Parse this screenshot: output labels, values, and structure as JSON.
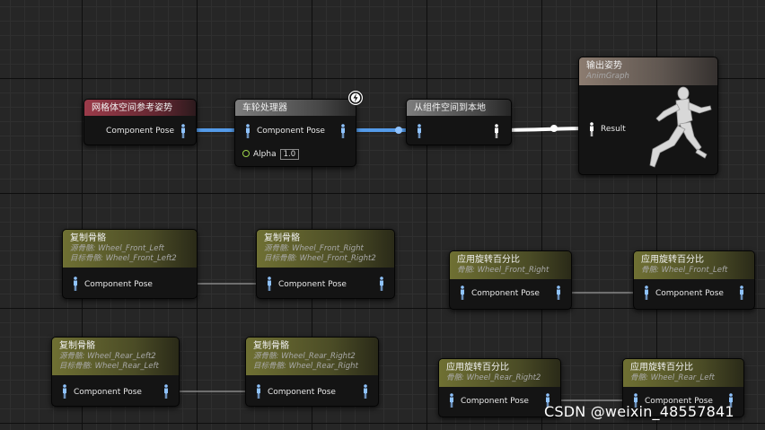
{
  "nodes": {
    "mesh_ref_pose": {
      "title": "网格体空间参考姿势",
      "pin": "Component Pose"
    },
    "wheel_handler": {
      "title": "车轮处理器",
      "pin": "Component Pose",
      "alpha_label": "Alpha",
      "alpha_value": "1.0"
    },
    "comp_to_local": {
      "title": "从组件空间到本地"
    },
    "output_pose": {
      "title": "输出姿势",
      "subtitle": "AnimGraph",
      "pin": "Result",
      "icon": "running-mannequin-icon"
    },
    "copy_bone_1": {
      "title": "复制骨骼",
      "source": "源骨骼: Wheel_Front_Left",
      "target": "目标骨骼: Wheel_Front_Left2",
      "pin": "Component Pose"
    },
    "copy_bone_2": {
      "title": "复制骨骼",
      "source": "源骨骼: Wheel_Front_Right",
      "target": "目标骨骼: Wheel_Front_Right2",
      "pin": "Component Pose"
    },
    "copy_bone_3": {
      "title": "复制骨骼",
      "source": "源骨骼: Wheel_Rear_Left2",
      "target": "目标骨骼: Wheel_Rear_Left",
      "pin": "Component Pose"
    },
    "copy_bone_4": {
      "title": "复制骨骼",
      "source": "源骨骼: Wheel_Rear_Right2",
      "target": "目标骨骼: Wheel_Rear_Right",
      "pin": "Component Pose"
    },
    "rot_pct_1": {
      "title": "应用旋转百分比",
      "bone": "骨骼: Wheel_Front_Right",
      "pin": "Component Pose"
    },
    "rot_pct_2": {
      "title": "应用旋转百分比",
      "bone": "骨骼: Wheel_Front_Left",
      "pin": "Component Pose"
    },
    "rot_pct_3": {
      "title": "应用旋转百分比",
      "bone": "骨骼: Wheel_Rear_Right2",
      "pin": "Component Pose"
    },
    "rot_pct_4": {
      "title": "应用旋转百分比",
      "bone": "骨骼: Wheel_Rear_Left",
      "pin": "Component Pose"
    }
  },
  "watermark": "CSDN @weixin_48557841",
  "colors": {
    "pose_pin": "#8fc3ff",
    "pose_wire": "#5aa8ff",
    "local_wire": "#ffffff",
    "grid_major": "#0e0e0e",
    "grid_minor": "#2f2f2f"
  }
}
